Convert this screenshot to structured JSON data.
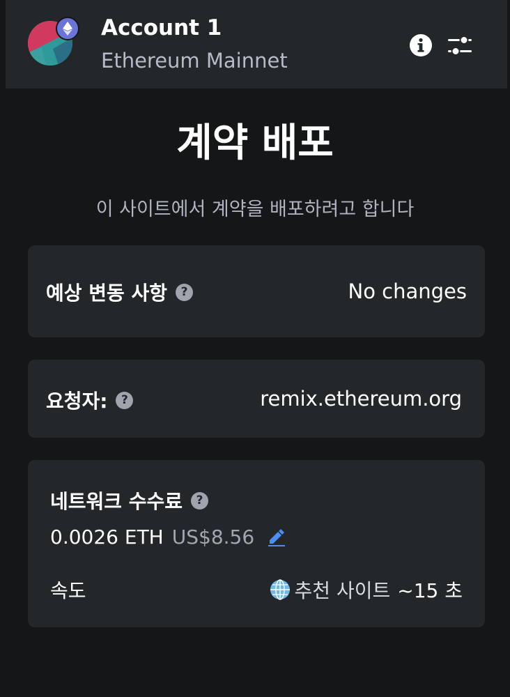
{
  "header": {
    "account_name": "Account 1",
    "network_name": "Ethereum Mainnet",
    "network_badge_icon": "ethereum-icon",
    "info_icon": "info-icon",
    "settings_icon": "sliders-icon"
  },
  "page": {
    "title": "계약 배포",
    "subtitle": "이 사이트에서 계약을 배포하려고 합니다"
  },
  "estimated_changes": {
    "label": "예상 변동 사항",
    "value": "No changes"
  },
  "requester": {
    "label": "요청자:",
    "value": "remix.ethereum.org"
  },
  "network_fee": {
    "label": "네트워크 수수료",
    "eth": "0.0026 ETH",
    "usd": "US$8.56",
    "speed_label": "속도",
    "speed_option": "추천 사이트",
    "speed_time": "~15 초"
  },
  "colors": {
    "background": "#141618",
    "card": "#24272a",
    "accent_blue": "#4c8df6",
    "badge": "#6a74d9",
    "muted_text": "#b7bbc8"
  }
}
